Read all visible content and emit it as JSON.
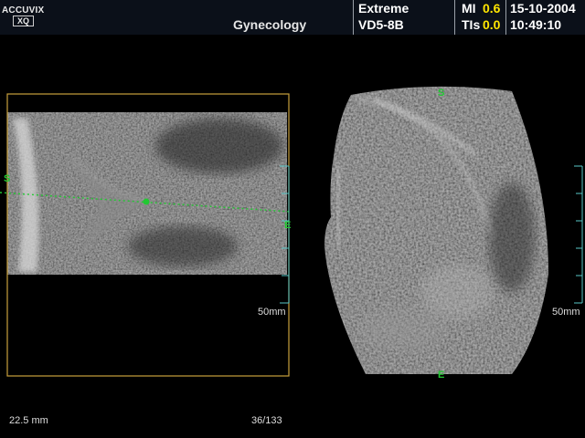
{
  "header": {
    "logo_top": "ACCUVIX",
    "logo_bottom": "XQ",
    "application": "Gynecology",
    "preset": "Extreme",
    "probe": "VD5-8B",
    "mi_label": "MI",
    "mi_value": "0.6",
    "tis_label": "TIs",
    "tis_value": "0.0",
    "date": "15-10-2004",
    "time": "10:49:10"
  },
  "left_view": {
    "start_marker": "S",
    "end_marker": "E",
    "depth_label": "50mm"
  },
  "right_view": {
    "start_marker": "S",
    "end_marker": "E",
    "depth_label": "50mm"
  },
  "footer": {
    "measurement": "22.5 mm",
    "frame_counter": "36/133"
  },
  "colors": {
    "marker_green": "#22c832",
    "roi_box": "#c8a03c",
    "scale_cyan": "#58c8c8",
    "index_yellow": "#ffe600"
  }
}
